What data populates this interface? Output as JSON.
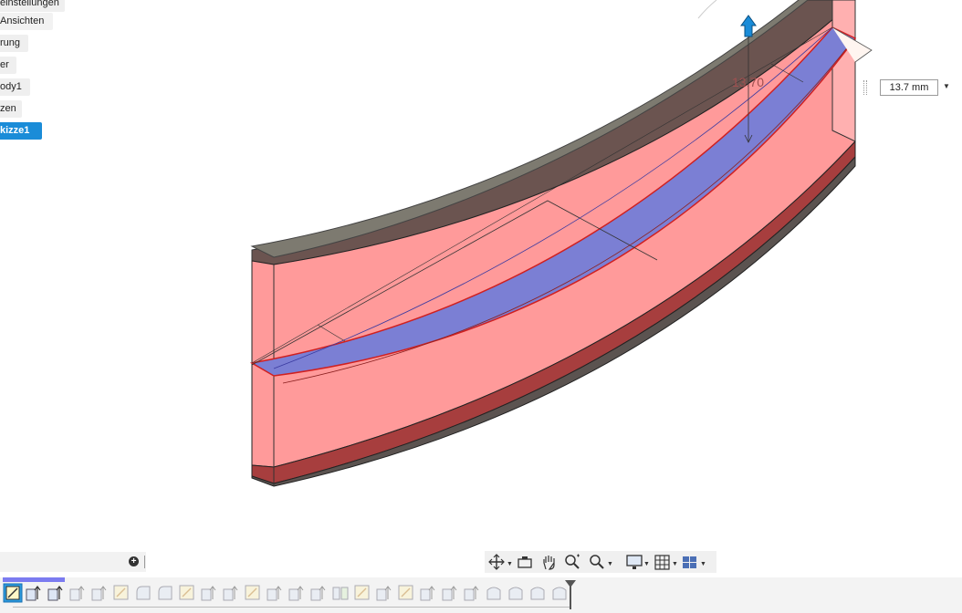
{
  "browser": {
    "items": [
      {
        "label": "einstellungen",
        "active": false
      },
      {
        "label": "Ansichten",
        "active": false
      },
      {
        "label": "rung",
        "active": false
      },
      {
        "label": "er",
        "active": false
      },
      {
        "label": "ody1",
        "active": false
      },
      {
        "label": "zen",
        "active": false
      },
      {
        "label": "kizze1",
        "active": true
      }
    ]
  },
  "canvas": {
    "dimension_label": "13.70",
    "dimension_input_value": "13.7 mm",
    "colors": {
      "face_fill": "#ff9a9a",
      "face_dark": "#9a3a3a",
      "top_edge": "#6b5450",
      "selected_band": "#7b7fd4",
      "manipulator_arrow": "#1a8cd8"
    }
  },
  "comments": {
    "add_icon": "plus-circle-icon"
  },
  "navigation_toolbar": {
    "icons": [
      "orbit-icon",
      "look-at-icon",
      "pan-icon",
      "zoom-icon",
      "zoom-window-icon",
      "display-settings-icon",
      "grid-icon",
      "viewports-icon"
    ]
  },
  "timeline": {
    "items": [
      "sketch-icon",
      "extrude-icon",
      "extrude-icon",
      "extrude-icon",
      "extrude-icon",
      "sketch-icon",
      "fillet-icon",
      "fillet-icon",
      "sketch-icon",
      "extrude-icon",
      "extrude-icon",
      "sketch-icon",
      "extrude-icon",
      "extrude-icon",
      "extrude-icon",
      "split-icon",
      "sketch-icon",
      "extrude-icon",
      "sketch-icon",
      "extrude-icon",
      "extrude-icon",
      "extrude-icon",
      "revolve-icon",
      "revolve-icon",
      "revolve-icon",
      "revolve-icon"
    ]
  }
}
